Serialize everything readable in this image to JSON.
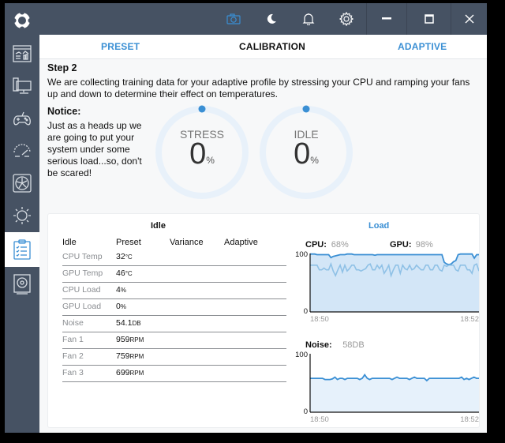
{
  "titlebar": {
    "icons": [
      "camera-icon",
      "moon-icon",
      "bell-icon",
      "gear-icon"
    ],
    "window_controls": [
      "minimize",
      "maximize",
      "close"
    ],
    "accent": "#3a8fd4"
  },
  "sidebar": {
    "items": [
      {
        "name": "logo",
        "active": false
      },
      {
        "name": "dashboard",
        "active": false
      },
      {
        "name": "system",
        "active": false
      },
      {
        "name": "gaming",
        "active": false
      },
      {
        "name": "performance",
        "active": false
      },
      {
        "name": "fan",
        "active": false
      },
      {
        "name": "lighting",
        "active": false
      },
      {
        "name": "calibration",
        "active": true
      },
      {
        "name": "audio",
        "active": false
      }
    ]
  },
  "tabs": [
    {
      "label": "PRESET",
      "active": false
    },
    {
      "label": "CALIBRATION",
      "active": true
    },
    {
      "label": "ADAPTIVE",
      "active": false
    }
  ],
  "step": {
    "title": "Step 2",
    "description": "We are collecting training data for your adaptive profile by stressing your CPU and ramping your fans up and down to determine their effect on temperatures.",
    "notice_title": "Notice:",
    "notice_text": "Just as a heads up we are going to put your system under some serious load...so, don't be scared!"
  },
  "progress": [
    {
      "label": "STRESS",
      "value": "0",
      "unit": "%",
      "fraction": 0
    },
    {
      "label": "IDLE",
      "value": "0",
      "unit": "%",
      "fraction": 0
    }
  ],
  "table": {
    "title": "Idle",
    "headers": [
      "Idle",
      "Preset",
      "Variance",
      "Adaptive"
    ],
    "rows": [
      {
        "label": "CPU Temp",
        "value": "32",
        "unit": "°C"
      },
      {
        "label": "GPU Temp",
        "value": "46",
        "unit": "°C"
      },
      {
        "label": "CPU Load",
        "value": "4",
        "unit": "%"
      },
      {
        "label": "GPU Load",
        "value": "0",
        "unit": "%"
      },
      {
        "label": "Noise",
        "value": "54.1",
        "unit": "DB"
      },
      {
        "label": "Fan 1",
        "value": "959",
        "unit": "RPM"
      },
      {
        "label": "Fan 2",
        "value": "759",
        "unit": "RPM"
      },
      {
        "label": "Fan 3",
        "value": "699",
        "unit": "RPM"
      }
    ]
  },
  "chart_data": [
    {
      "type": "area",
      "title": "Load",
      "legend": [
        {
          "name": "CPU:",
          "value": "68%"
        },
        {
          "name": "GPU:",
          "value": "98%"
        }
      ],
      "ylim": [
        0,
        100
      ],
      "yticks": [
        "100",
        "0"
      ],
      "xticks": [
        "18:50",
        "18:52"
      ],
      "series": [
        {
          "name": "GPU",
          "color": "#3a8fd4",
          "values": [
            99,
            99,
            99,
            98,
            98,
            98,
            98,
            98,
            98,
            93,
            95,
            96,
            97,
            98,
            98,
            98,
            99,
            99,
            99,
            98,
            98,
            98,
            98,
            98,
            98,
            98,
            98,
            98,
            97,
            98,
            98,
            98,
            98,
            98,
            98,
            98,
            98,
            98,
            98,
            98,
            98,
            98,
            98,
            98,
            98,
            98,
            98,
            98,
            98,
            98,
            98,
            98,
            98,
            98,
            98,
            98,
            98,
            98,
            85,
            82,
            81,
            82,
            86,
            88,
            98,
            99,
            99,
            99,
            99,
            99,
            99,
            92,
            98,
            98
          ]
        },
        {
          "name": "CPU",
          "color": "#8fc1e6",
          "values": [
            80,
            80,
            80,
            80,
            72,
            72,
            75,
            72,
            72,
            82,
            70,
            62,
            72,
            80,
            68,
            80,
            70,
            74,
            80,
            80,
            72,
            72,
            70,
            72,
            74,
            80,
            82,
            72,
            72,
            80,
            74,
            80,
            66,
            72,
            80,
            62,
            72,
            80,
            80,
            66,
            80,
            74,
            72,
            80,
            72,
            74,
            80,
            76,
            72,
            72,
            80,
            80,
            72,
            72,
            80,
            80,
            72,
            70,
            80,
            78,
            80,
            80,
            80,
            72,
            70,
            80,
            80,
            80,
            72,
            72,
            66,
            80,
            82,
            70
          ]
        }
      ]
    },
    {
      "type": "area",
      "title": "Noise",
      "legend": [
        {
          "name": "Noise:",
          "value": "58DB"
        }
      ],
      "ylim": [
        0,
        100
      ],
      "yticks": [
        "100",
        "0"
      ],
      "xticks": [
        "18:50",
        "18:52"
      ],
      "series": [
        {
          "name": "Noise",
          "color": "#3a8fd4",
          "values": [
            58,
            58,
            58,
            58,
            58,
            58,
            56,
            56,
            56,
            57,
            60,
            56,
            58,
            58,
            56,
            58,
            58,
            58,
            58,
            58,
            56,
            58,
            64,
            58,
            56,
            58,
            58,
            58,
            58,
            58,
            58,
            58,
            58,
            56,
            58,
            60,
            58,
            58,
            58,
            58,
            56,
            58,
            60,
            58,
            58,
            58,
            58,
            54,
            58,
            58,
            58,
            58,
            58,
            58,
            58,
            58,
            58,
            58,
            58,
            58,
            58,
            60,
            56,
            58,
            56,
            58,
            60,
            58,
            58
          ]
        }
      ]
    }
  ]
}
